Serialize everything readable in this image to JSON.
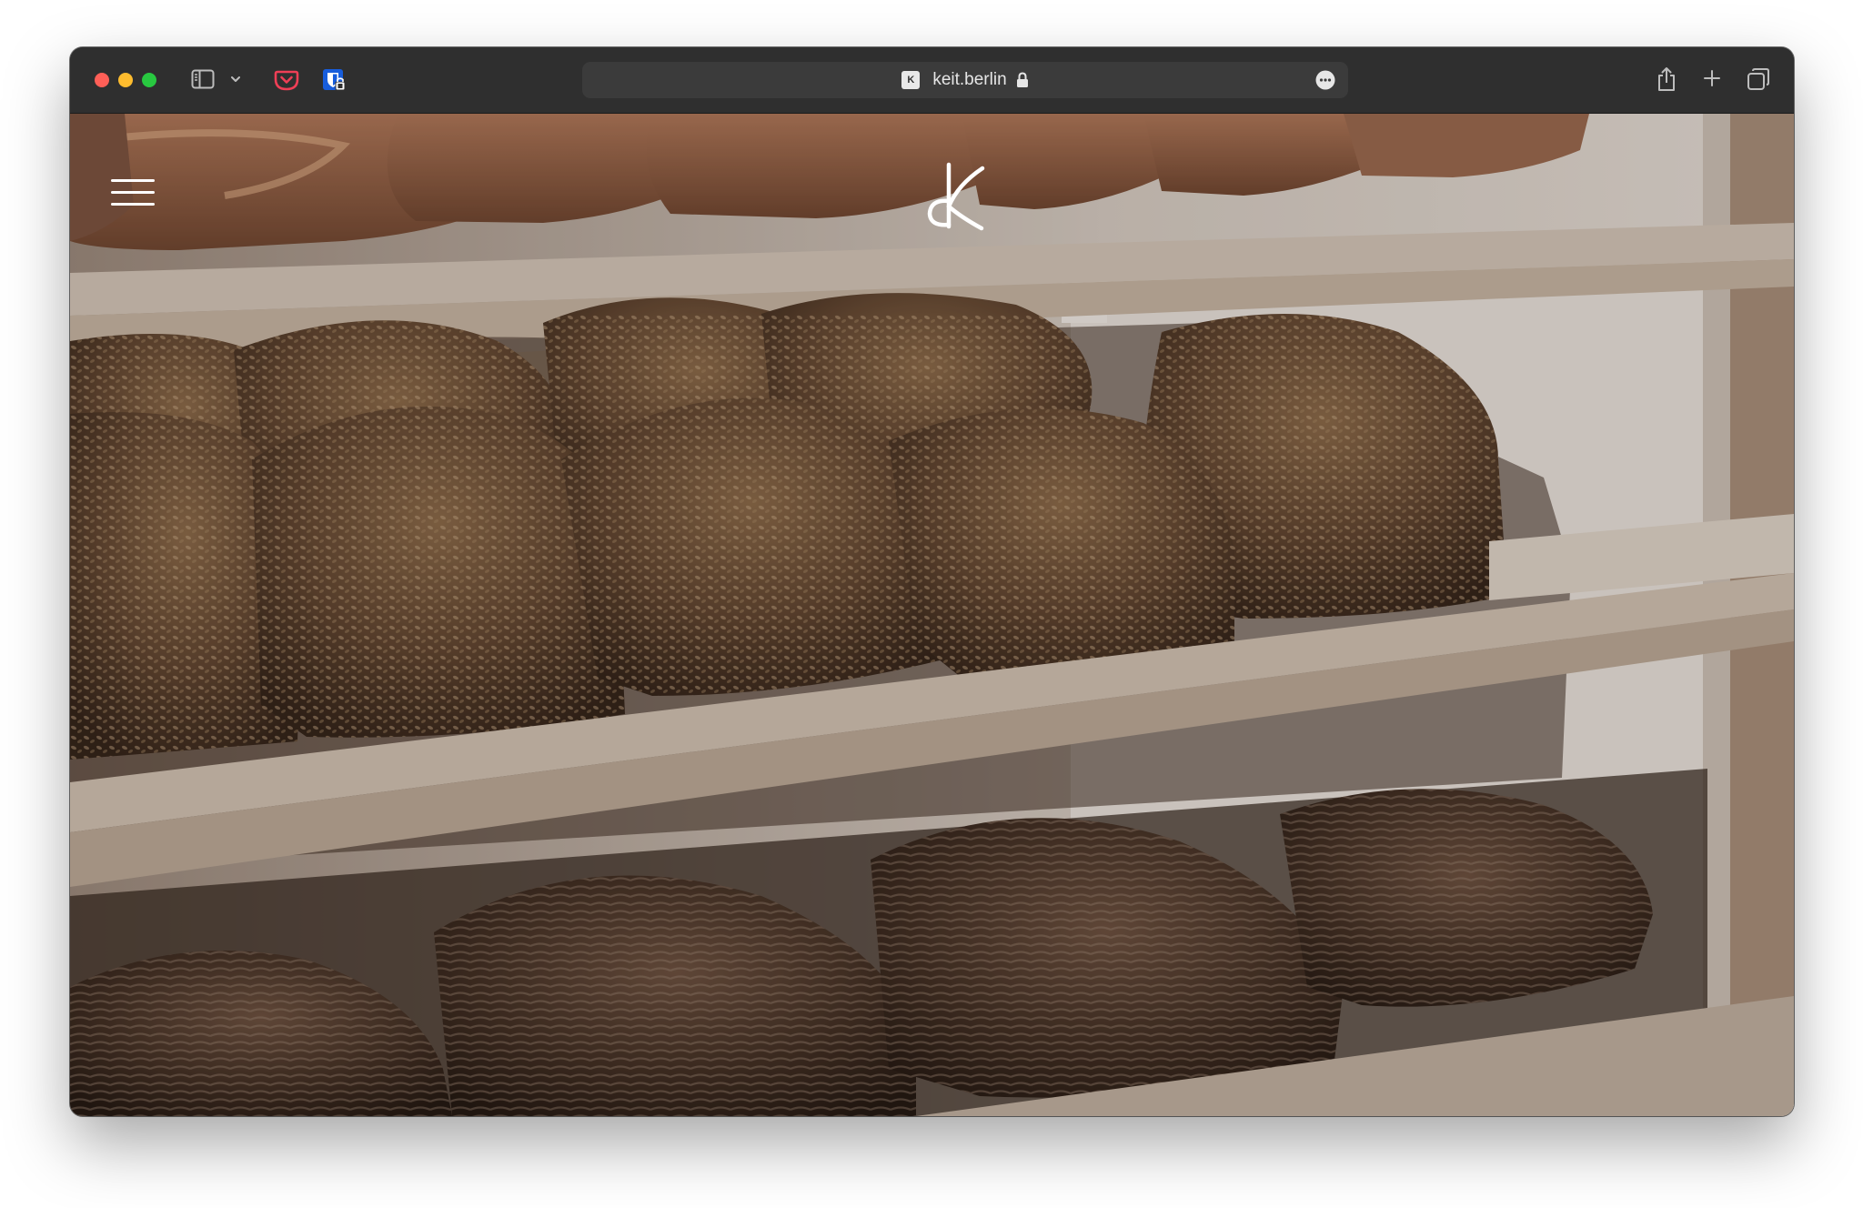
{
  "browser": {
    "url": "keit.berlin",
    "favicon_label": "K",
    "icons": {
      "sidebar": "sidebar-icon",
      "sidebar_menu": "chevron-down-icon",
      "pocket": "pocket-icon",
      "bitwarden": "bitwarden-icon",
      "lock": "lock-icon",
      "more": "more-icon",
      "share": "share-icon",
      "new_tab": "plus-icon",
      "tab_overview": "tabs-icon"
    },
    "traffic_colors": {
      "close": "#ff5f57",
      "minimize": "#febc2e",
      "maximize": "#28c840"
    }
  },
  "site": {
    "logo": "keit-logo",
    "menu": "hamburger-menu-icon",
    "hero": "bread-shelves-photo",
    "overlay_color": "#2a1a10"
  }
}
